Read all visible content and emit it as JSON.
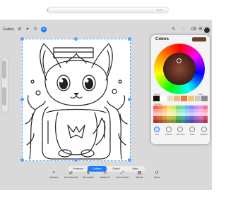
{
  "device": {
    "pencil_label": "Pencil"
  },
  "toolbar": {
    "gallery_label": "Gallery",
    "left_icons": [
      "wrench-icon",
      "magic-wand-icon",
      "selection-icon",
      "transform-icon"
    ],
    "right_icons": [
      "brush-icon",
      "smudge-icon",
      "eraser-icon",
      "layers-icon"
    ],
    "current_color": "#2b2b2b"
  },
  "colors_panel": {
    "title": "Colors",
    "current_color": "#6e3e2e",
    "history_label": "History",
    "clear_label": "Clear",
    "palettes_label": "Palettes",
    "history": [
      "#111111",
      "#ffffff",
      "#e9dcc7",
      "#f2b880",
      "#f07a3a",
      "#f4c76c",
      "#c9c9c9",
      "#8a8a8a"
    ],
    "palette_rows": [
      [
        "#ff5a5a",
        "#ff7f50",
        "#ffb347",
        "#ffd966",
        "#c5e86c",
        "#7fd67f",
        "#66d9c6",
        "#66b3ff",
        "#8c8cff",
        "#c58cff",
        "#ff8cd9",
        "#ff6f91"
      ],
      [
        "#ff9a9a",
        "#ffb08a",
        "#ffcf8a",
        "#ffe89a",
        "#dcf29a",
        "#a8e6a8",
        "#99eadd",
        "#99ccff",
        "#b3b3ff",
        "#d9b3ff",
        "#ffb3e6",
        "#ffa3b8"
      ],
      [
        "#ffc4c4",
        "#ffd0b8",
        "#ffe2b8",
        "#fff2c2",
        "#ebf7c2",
        "#c9f0c9",
        "#c2f2eb",
        "#c2e0ff",
        "#d1d1ff",
        "#e8d1ff",
        "#ffd1f0",
        "#ffc9d6"
      ],
      [
        "#d94c4c",
        "#d96b3f",
        "#d9973f",
        "#d9b84c",
        "#a6c94c",
        "#5fb35f",
        "#4cb3a3",
        "#4c8fd9",
        "#6b6bd9",
        "#a36bd9",
        "#d96bb8",
        "#d94c72"
      ],
      [
        "#a63a3a",
        "#a65230",
        "#a67330",
        "#a68c3a",
        "#809a3a",
        "#478a47",
        "#3a8a7e",
        "#3a6da6",
        "#5252a6",
        "#7e52a6",
        "#a6528c",
        "#a63a57"
      ]
    ],
    "tabs": [
      {
        "label": "Disc",
        "icon": "disc-icon",
        "active": true
      },
      {
        "label": "Classic",
        "icon": "classic-icon",
        "active": false
      },
      {
        "label": "Harmony",
        "icon": "harmony-icon",
        "active": false
      },
      {
        "label": "Value",
        "icon": "value-icon",
        "active": false
      },
      {
        "label": "Palettes",
        "icon": "palettes-icon",
        "active": false
      }
    ]
  },
  "transform": {
    "modes": [
      {
        "label": "Freeform",
        "active": false
      },
      {
        "label": "Uniform",
        "active": true
      },
      {
        "label": "Distort",
        "active": false
      },
      {
        "label": "Warp",
        "active": false
      }
    ],
    "buttons": [
      {
        "label": "Snapping",
        "icon": "snapping-icon"
      },
      {
        "label": "Flip Horizontal",
        "icon": "flip-horizontal-icon"
      },
      {
        "label": "Flip Vertical",
        "icon": "flip-vertical-icon"
      },
      {
        "label": "Rotate 45°",
        "icon": "rotate-icon"
      },
      {
        "label": "Fit to Canvas",
        "icon": "fit-canvas-icon"
      },
      {
        "label": "Bilinear",
        "icon": "interpolation-icon"
      },
      {
        "label": "Reset",
        "icon": "reset-icon"
      }
    ]
  }
}
